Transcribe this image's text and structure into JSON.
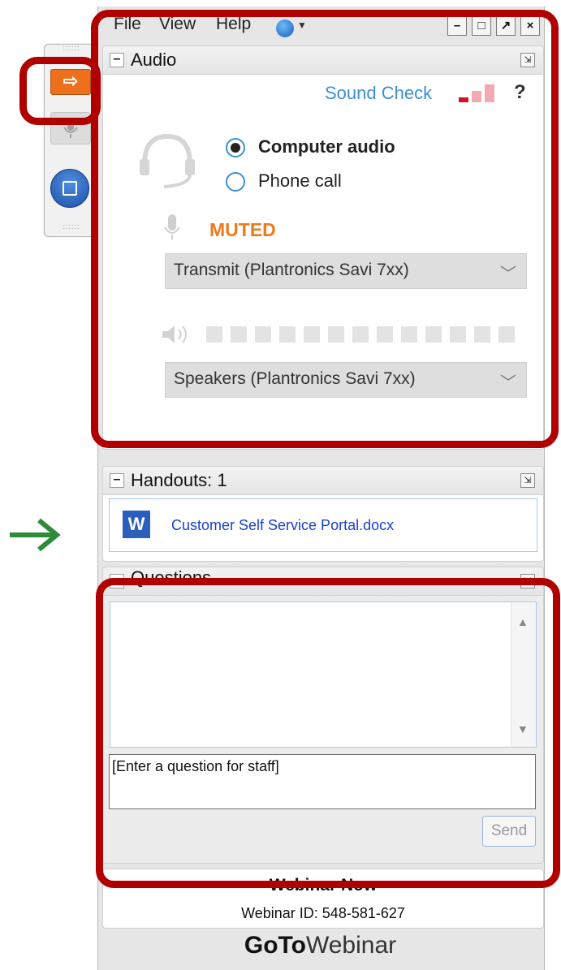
{
  "menu": {
    "file": "File",
    "view": "View",
    "help": "Help"
  },
  "audio": {
    "title": "Audio",
    "sound_check": "Sound Check",
    "help": "?",
    "options": [
      {
        "label": "Computer audio",
        "selected": true
      },
      {
        "label": "Phone call",
        "selected": false
      }
    ],
    "status": "MUTED",
    "microphone": "Transmit (Plantronics Savi 7xx)",
    "speakers": "Speakers (Plantronics Savi 7xx)"
  },
  "handouts": {
    "title": "Handouts: 1",
    "file_icon": "W",
    "files": [
      "Customer Self Service Portal.docx"
    ]
  },
  "questions": {
    "title": "Questions",
    "placeholder": "[Enter a question for staff]",
    "send": "Send"
  },
  "footer": {
    "webinar_name": "Webinar Now",
    "webinar_id": "Webinar ID: 548-581-627",
    "brand_bold": "GoTo",
    "brand_rest": "Webinar"
  },
  "colors": {
    "accent": "#3b8fd6",
    "muted": "#ee7a1a",
    "annotation": "#b00000",
    "arrow": "#2e8b3c"
  }
}
